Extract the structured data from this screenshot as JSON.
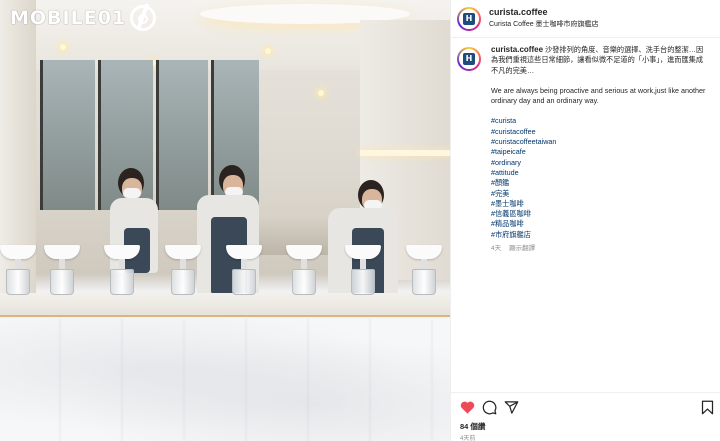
{
  "watermark": {
    "text": "MOBILE01"
  },
  "post": {
    "username": "curista.coffee",
    "location": "Curista Coffee 墨士咖啡市府旗艦店",
    "avatar_text": "H",
    "caption_zh": "沙發排列的角度、音樂的選擇、洗手台的整潔…因為我們重視這些日常細節，讓看似微不足道的「小事」，進而匯集成不凡的完美…",
    "caption_en": "We are always being proactive and serious at work,just like another ordinary day and an ordinary way.",
    "hashtags": [
      "#curista",
      "#curistacoffee",
      "#curistacoffeetaiwan",
      "#taipeicafe",
      "#ordinary",
      "#attitude",
      "#顏鑑",
      "#完美",
      "#墨士咖啡",
      "#信義區咖啡",
      "#精品咖啡",
      "#市府旗艦店"
    ],
    "time_ago": "4天",
    "translate_label": "顯示翻譯"
  },
  "actions": {
    "icons": [
      "heart-icon",
      "comment-icon",
      "share-icon",
      "bookmark-icon"
    ],
    "likes_text": "84 個讚",
    "age_text": "4天前"
  },
  "colors": {
    "like_red": "#ed4956",
    "hashtag_blue": "#00376b",
    "meta_gray": "#8e8e8e"
  }
}
